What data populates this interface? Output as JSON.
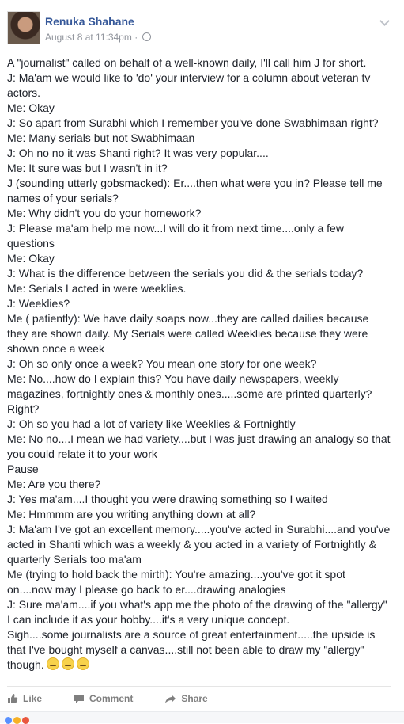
{
  "post": {
    "author": "Renuka Shahane",
    "timestamp": "August 8 at 11:34pm",
    "separator": "·",
    "lines": [
      "A \"journalist\" called on behalf of a well-known daily, I'll call him J for short.",
      "J: Ma'am we would like to 'do' your interview for a column about veteran tv actors.",
      "Me: Okay",
      "J: So apart from Surabhi which I remember you've done Swabhimaan right?",
      "Me: Many serials but not Swabhimaan",
      "J: Oh no no it was Shanti right? It was very popular....",
      "Me: It sure was but I wasn't in it?",
      "J (sounding utterly gobsmacked): Er....then what were you in? Please tell me names of your serials?",
      "Me: Why didn't you do your homework?",
      "J: Please ma'am help me now...I will do it from next time....only a few questions",
      "Me: Okay",
      "J: What is the difference between the serials you did & the serials today?",
      "Me: Serials I acted in were weeklies.",
      "J: Weeklies?",
      "Me ( patiently): We have daily soaps now...they are called dailies because they are shown daily. My Serials were called Weeklies because they were shown once a week",
      "J: Oh so only once a week? You mean one story for one week?",
      "Me: No....how do I explain this? You have daily newspapers, weekly magazines, fortnightly ones & monthly ones.....some are printed quarterly? Right?",
      "J: Oh so you had a lot of variety like Weeklies & Fortnightly",
      "Me: No no....I mean we had variety....but I was just drawing an analogy so that you could relate it to your work",
      "Pause",
      "Me: Are you there?",
      "J: Yes ma'am....I thought you were drawing something so I waited",
      "Me: Hmmmm are you writing anything down at all?",
      "J: Ma'am I've got an excellent memory.....you've acted in Surabhi....and you've acted in Shanti which was a weekly & you acted in a variety of Fortnightly & quarterly Serials too ma'am",
      "Me (trying to hold back the mirth): You're amazing....you've got it spot on....now may I please go back to er....drawing analogies",
      "J: Sure ma'am....if you what's app me the photo of the drawing of the \"allergy\" I can include it as your hobby....it's a very unique concept.",
      "Sigh....some journalists are a source of great entertainment.....the upside is that I've bought myself a canvas....still not been able to draw my \"allergy\" though."
    ]
  },
  "actions": {
    "like": "Like",
    "comment": "Comment",
    "share": "Share"
  },
  "colors": {
    "name": "#365899",
    "meta": "#90949c",
    "text": "#1d2129",
    "action": "#7f7f7f"
  }
}
